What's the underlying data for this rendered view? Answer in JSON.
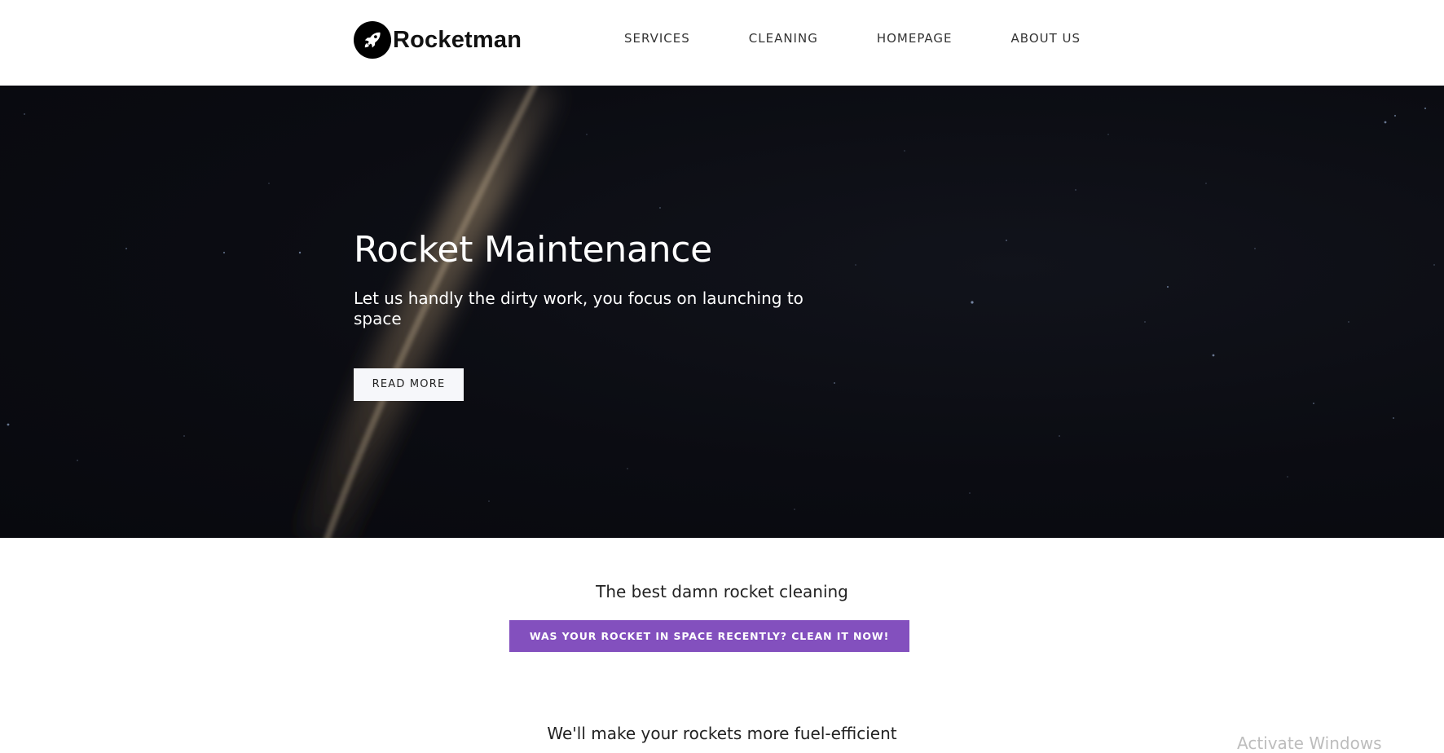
{
  "brand": {
    "name": "Rocketman",
    "logo_icon": "rocket-icon"
  },
  "nav": {
    "items": [
      {
        "label": "SERVICES"
      },
      {
        "label": "CLEANING"
      },
      {
        "label": "HOMEPAGE"
      },
      {
        "label": "ABOUT US"
      }
    ]
  },
  "hero": {
    "title": "Rocket Maintenance",
    "subtitle": "Let us handly the dirty work, you focus on launching to space",
    "button_label": "READ MORE"
  },
  "tagline": "The best damn rocket cleaning",
  "cta": {
    "label": "WAS YOUR ROCKET IN SPACE RECENTLY? CLEAN IT NOW!"
  },
  "section": {
    "heading": "We'll make your rockets more fuel-efficient"
  },
  "overlay": {
    "activate_windows": "Activate Windows"
  },
  "colors": {
    "accent": "#8350be",
    "hero_background": "#0b0c12",
    "header_background": "#ffffff"
  }
}
